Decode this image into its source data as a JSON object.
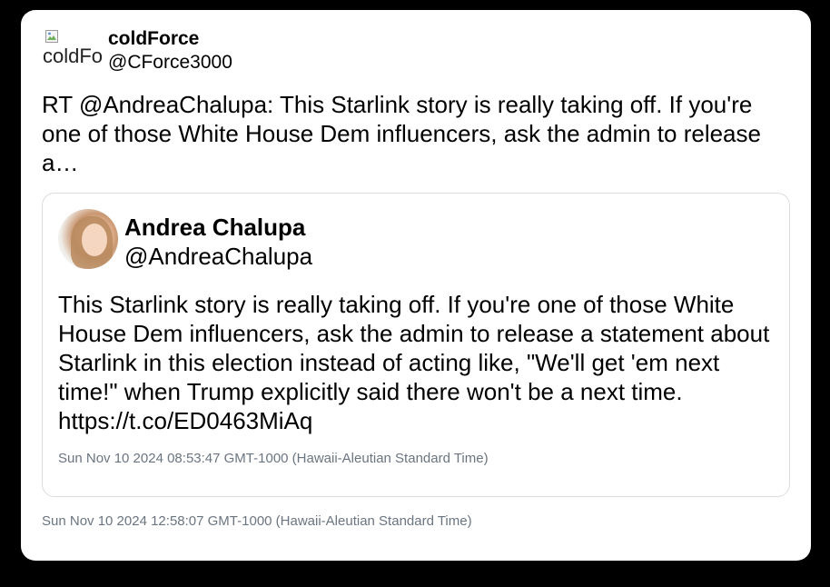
{
  "tweet": {
    "author": {
      "avatar_alt": "coldForce",
      "display_name": "coldForce",
      "handle": "@CForce3000"
    },
    "text": "RT @AndreaChalupa: This Starlink story is really taking off. If you're one of those White House Dem influencers, ask the admin to release a…",
    "timestamp": "Sun Nov 10 2024 12:58:07 GMT-1000 (Hawaii-Aleutian Standard Time)"
  },
  "quoted_tweet": {
    "author": {
      "display_name": "Andrea Chalupa",
      "handle": "@AndreaChalupa"
    },
    "text": "This Starlink story is really taking off. If you're one of those White House Dem influencers, ask the admin to release a statement about Starlink in this election instead of acting like, \"We'll get 'em next time!\" when Trump explicitly said there won't be a next time. https://t.co/ED0463MiAq",
    "timestamp": "Sun Nov 10 2024 08:53:47 GMT-1000 (Hawaii-Aleutian Standard Time)"
  },
  "colors": {
    "background": "#000000",
    "card": "#ffffff",
    "border": "#d9dde1",
    "timestamp": "#6b7580"
  }
}
